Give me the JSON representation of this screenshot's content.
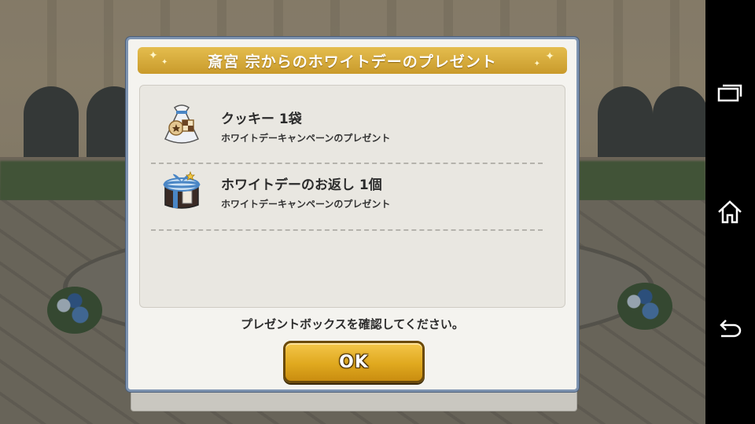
{
  "dialog": {
    "title": "斎宮 宗からのホワイトデーのプレゼント",
    "items": [
      {
        "name": "クッキー 1袋",
        "desc": "ホワイトデーキャンペーンのプレゼント",
        "icon": "cookie-bag-icon"
      },
      {
        "name": "ホワイトデーのお返し 1個",
        "desc": "ホワイトデーキャンペーンのプレゼント",
        "icon": "gift-box-icon"
      }
    ],
    "message": "プレゼントボックスを確認してください。",
    "ok_label": "OK"
  },
  "navbar": {
    "buttons": [
      "recent-apps-icon",
      "home-icon",
      "back-icon"
    ]
  },
  "colors": {
    "banner": "#d4a93a",
    "ok_button": "#e0a91f",
    "dialog_border": "#7d93b0",
    "navbar": "#000000"
  }
}
